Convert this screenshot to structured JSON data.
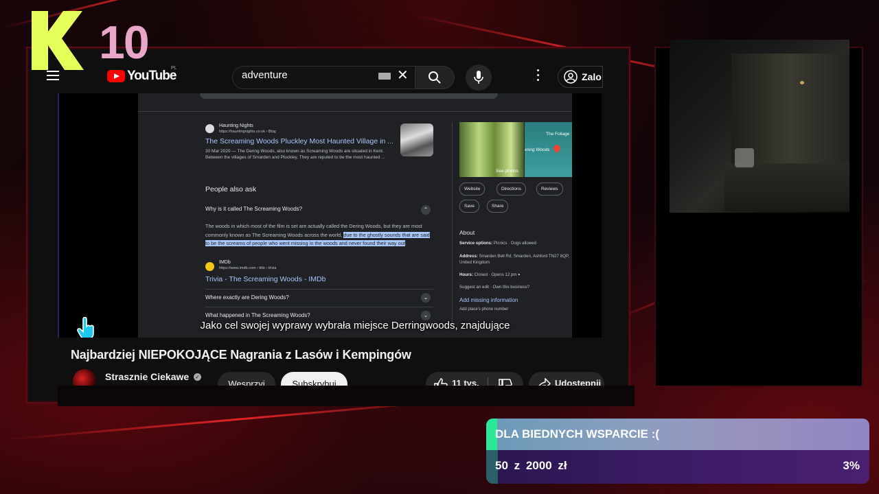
{
  "overlay": {
    "logo_number": "10",
    "donation": {
      "title": "DLA BIEDNYCH WSPARCIE :(",
      "amount_text": "50 z 2000 zł",
      "current": 50,
      "goal": 2000,
      "percent_label": "3%",
      "progress_fraction": 0.03
    },
    "colors": {
      "accent_green": "#2ee89a",
      "streak_red": "#ff2a2a",
      "logo_lime": "#e6ff59",
      "logo_pink": "#e8a6c8"
    }
  },
  "youtube": {
    "logo_text": "YouTube",
    "country": "PL",
    "search_value": "adventure",
    "login_label": "Zalo",
    "video_title": "Najbardziej NIEPOKOJĄCE Nagrania z Lasów i Kempingów",
    "channel_name": "Strasznie Ciekawe",
    "support_label": "Wesprzyj",
    "subscribe_label": "Subskrybuj",
    "likes": "11 tys.",
    "share_label": "Udostępnij",
    "subtitle": "Jako cel swojej wyprawy wybrała miejsce Derringwoods, znajdujące"
  },
  "google_result": {
    "site_name": "Haunting Nights",
    "site_url": "https://hauntingnights.co.uk › Blog",
    "title": "The Screaming Woods Pluckley Most Haunted Village in ...",
    "snippet": "30 Mar 2020 — The Dering Woods, also known as Screaming Woods are situated in Kent. Between the villages of Smarden and Pluckley. They are reputed to be the most haunted ...",
    "paa_title": "People also ask",
    "paa_q1": "Why is it called The Screaming Woods?",
    "paa_answer_plain": "The woods in which most of the film is set are actually called the Dering Woods, but they are most commonly known as The Screaming Woods across the world,",
    "paa_answer_highlight": "due to the ghostly sounds that are said to be the screams of people who went missing in the woods and never found their way out",
    "paa_answer_end": ".",
    "imdb_site": "IMDb",
    "imdb_url": "https://www.imdb.com › title › trivia",
    "imdb_title": "Trivia - The Screaming Woods - IMDb",
    "paa_q2": "Where exactly are Dering Woods?",
    "paa_q3": "What happened in The Screaming Woods?"
  },
  "knowledge_panel": {
    "see_photos": "See photos",
    "map_label": "The Foliage",
    "map_label2": "ering Woods",
    "btn_website": "Website",
    "btn_directions": "Directions",
    "btn_reviews": "Reviews",
    "btn_save": "Save",
    "btn_share": "Share",
    "about": "About",
    "service_label": "Service options:",
    "service_value": "Picnics · Dogs allowed",
    "address_label": "Address:",
    "address_value": "Smarden Bell Rd, Smarden, Ashford TN27 8QP, United Kingdom",
    "hours_label": "Hours:",
    "hours_value": "Closed · Opens 12 pm ▾",
    "suggest": "Suggest an edit · Own this business?",
    "add_missing": "Add missing information",
    "add_phone": "Add place's phone number"
  }
}
